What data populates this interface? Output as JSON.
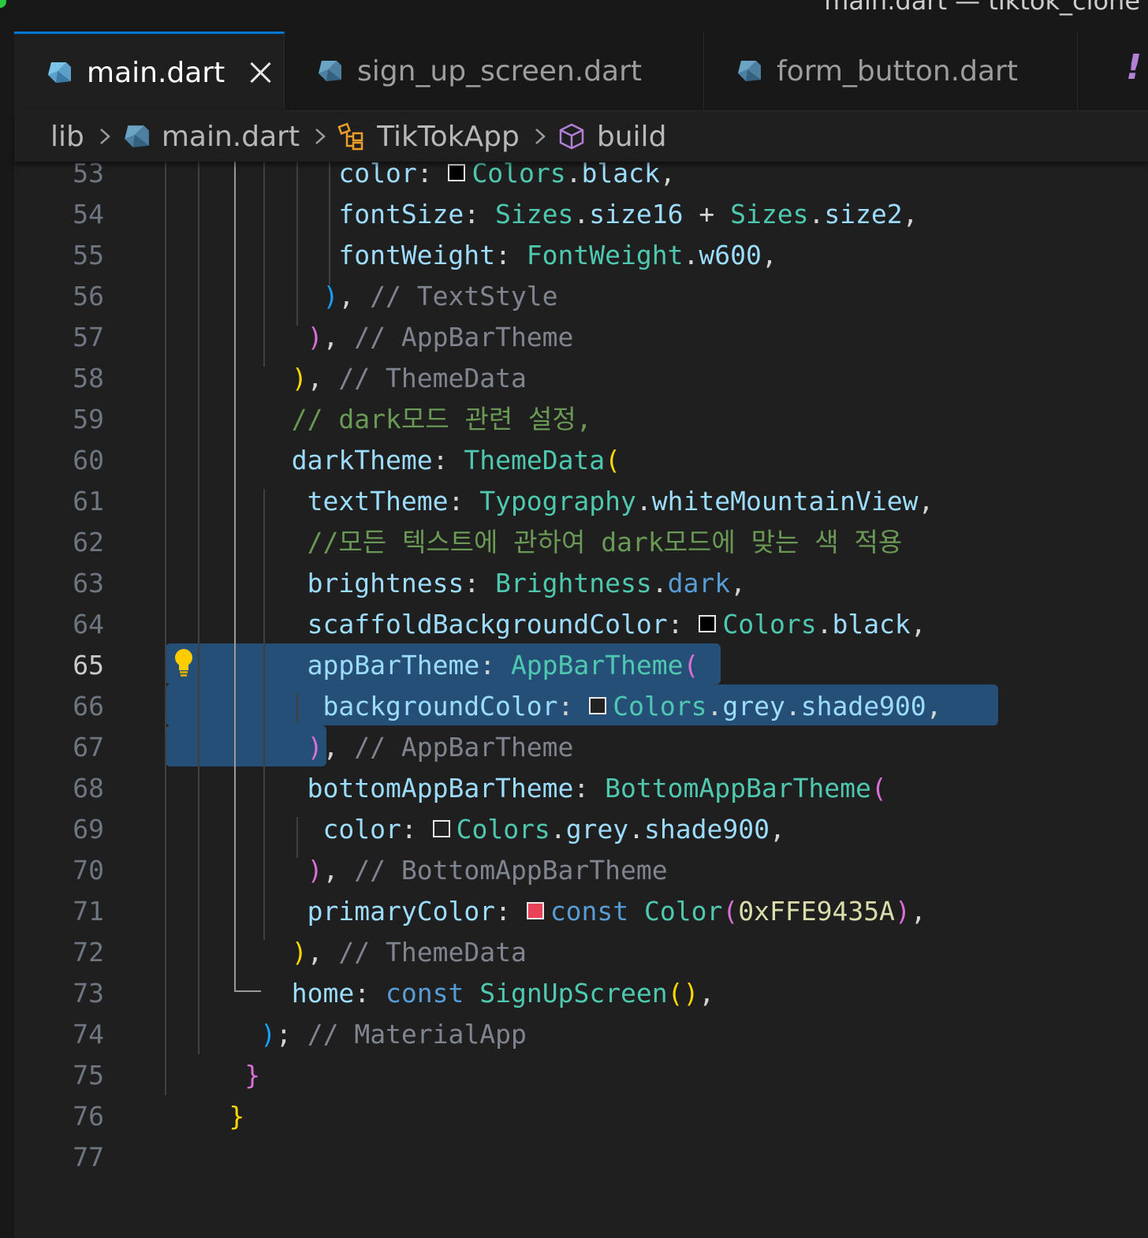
{
  "window": {
    "title": "main.dart — tiktok_clone"
  },
  "tabs": [
    {
      "label": "main.dart",
      "icon": "dart-icon",
      "active": true,
      "closable": true
    },
    {
      "label": "sign_up_screen.dart",
      "icon": "dart-icon",
      "active": false
    },
    {
      "label": "form_button.dart",
      "icon": "dart-icon",
      "active": false
    }
  ],
  "tab_overflow_indicator": "!",
  "breadcrumb": {
    "items": [
      {
        "label": "lib",
        "icon": null
      },
      {
        "label": "main.dart",
        "icon": "dart-icon"
      },
      {
        "label": "TikTokApp",
        "icon": "class-icon"
      },
      {
        "label": "build",
        "icon": "method-cube-icon"
      }
    ]
  },
  "editor": {
    "current_line": 65,
    "colors": {
      "keyword": "#569cd6",
      "property": "#9cdcfe",
      "type": "#4ec9b0",
      "method": "#dcdcaa",
      "comment": "#6a9955",
      "comment_gray": "#7f848e",
      "bracket_yellow": "#ffd700",
      "bracket_pink": "#da70d6",
      "bracket_blue": "#179fff",
      "selection": "#264f78"
    },
    "lines": [
      {
        "n": "53",
        "tokens": [
          [
            "prop",
            "color"
          ],
          [
            "plain",
            ": "
          ],
          [
            "swatch",
            "#000000"
          ],
          [
            "type",
            "Colors"
          ],
          [
            "plain",
            "."
          ],
          [
            "prop",
            "black"
          ],
          [
            "plain",
            ","
          ]
        ]
      },
      {
        "n": "54",
        "tokens": [
          [
            "prop",
            "fontSize"
          ],
          [
            "plain",
            ": "
          ],
          [
            "type",
            "Sizes"
          ],
          [
            "plain",
            "."
          ],
          [
            "prop",
            "size16"
          ],
          [
            "plain",
            " + "
          ],
          [
            "type",
            "Sizes"
          ],
          [
            "plain",
            "."
          ],
          [
            "prop",
            "size2"
          ],
          [
            "plain",
            ","
          ]
        ]
      },
      {
        "n": "55",
        "tokens": [
          [
            "prop",
            "fontWeight"
          ],
          [
            "plain",
            ": "
          ],
          [
            "type",
            "FontWeight"
          ],
          [
            "plain",
            "."
          ],
          [
            "prop",
            "w600"
          ],
          [
            "plain",
            ","
          ]
        ]
      },
      {
        "n": "56",
        "tokens": [
          [
            "bblue",
            ")"
          ],
          [
            "plain",
            ", "
          ],
          [
            "gcomment",
            "// TextStyle"
          ]
        ]
      },
      {
        "n": "57",
        "tokens": [
          [
            "bpink",
            ")"
          ],
          [
            "plain",
            ", "
          ],
          [
            "gcomment",
            "// AppBarTheme"
          ]
        ]
      },
      {
        "n": "58",
        "tokens": [
          [
            "byellow",
            ")"
          ],
          [
            "plain",
            ", "
          ],
          [
            "gcomment",
            "// ThemeData"
          ]
        ]
      },
      {
        "n": "59",
        "tokens": [
          [
            "comment",
            "// dark모드 관련 설정,"
          ]
        ]
      },
      {
        "n": "60",
        "tokens": [
          [
            "prop",
            "darkTheme"
          ],
          [
            "plain",
            ": "
          ],
          [
            "type",
            "ThemeData"
          ],
          [
            "byellow",
            "("
          ]
        ]
      },
      {
        "n": "61",
        "tokens": [
          [
            "prop",
            "textTheme"
          ],
          [
            "plain",
            ": "
          ],
          [
            "type",
            "Typography"
          ],
          [
            "plain",
            "."
          ],
          [
            "prop",
            "whiteMountainView"
          ],
          [
            "plain",
            ","
          ]
        ]
      },
      {
        "n": "62",
        "tokens": [
          [
            "comment",
            "//모든 텍스트에 관하여 dark모드에 맞는 색 적용"
          ]
        ]
      },
      {
        "n": "63",
        "tokens": [
          [
            "prop",
            "brightness"
          ],
          [
            "plain",
            ": "
          ],
          [
            "type",
            "Brightness"
          ],
          [
            "plain",
            "."
          ],
          [
            "kw",
            "dark"
          ],
          [
            "plain",
            ","
          ]
        ]
      },
      {
        "n": "64",
        "tokens": [
          [
            "prop",
            "scaffoldBackgroundColor"
          ],
          [
            "plain",
            ": "
          ],
          [
            "swatch",
            "#000000"
          ],
          [
            "type",
            "Colors"
          ],
          [
            "plain",
            "."
          ],
          [
            "prop",
            "black"
          ],
          [
            "plain",
            ","
          ]
        ]
      },
      {
        "n": "65",
        "tokens": [
          [
            "prop",
            "appBarTheme"
          ],
          [
            "plain",
            ": "
          ],
          [
            "type",
            "AppBarTheme"
          ],
          [
            "bpink",
            "("
          ]
        ]
      },
      {
        "n": "66",
        "tokens": [
          [
            "prop",
            "backgroundColor"
          ],
          [
            "plain",
            ": "
          ],
          [
            "swatch",
            "#212121"
          ],
          [
            "type",
            "Colors"
          ],
          [
            "plain",
            "."
          ],
          [
            "prop",
            "grey"
          ],
          [
            "plain",
            "."
          ],
          [
            "prop",
            "shade900"
          ],
          [
            "plain",
            ","
          ]
        ]
      },
      {
        "n": "67",
        "tokens": [
          [
            "bpink",
            ")"
          ],
          [
            "plain",
            ", "
          ],
          [
            "gcomment",
            "// AppBarTheme"
          ]
        ]
      },
      {
        "n": "68",
        "tokens": [
          [
            "prop",
            "bottomAppBarTheme"
          ],
          [
            "plain",
            ": "
          ],
          [
            "type",
            "BottomAppBarTheme"
          ],
          [
            "bpink",
            "("
          ]
        ]
      },
      {
        "n": "69",
        "tokens": [
          [
            "prop",
            "color"
          ],
          [
            "plain",
            ": "
          ],
          [
            "swatch",
            "#212121"
          ],
          [
            "type",
            "Colors"
          ],
          [
            "plain",
            "."
          ],
          [
            "prop",
            "grey"
          ],
          [
            "plain",
            "."
          ],
          [
            "prop",
            "shade900"
          ],
          [
            "plain",
            ","
          ]
        ]
      },
      {
        "n": "70",
        "tokens": [
          [
            "bpink",
            ")"
          ],
          [
            "plain",
            ", "
          ],
          [
            "gcomment",
            "// BottomAppBarTheme"
          ]
        ]
      },
      {
        "n": "71",
        "tokens": [
          [
            "prop",
            "primaryColor"
          ],
          [
            "plain",
            ": "
          ],
          [
            "swatch",
            "#E9435A"
          ],
          [
            "kw",
            "const"
          ],
          [
            "plain",
            " "
          ],
          [
            "type",
            "Color"
          ],
          [
            "bpink",
            "("
          ],
          [
            "num",
            "0xFFE9435A"
          ],
          [
            "bpink",
            ")"
          ],
          [
            "plain",
            ","
          ]
        ]
      },
      {
        "n": "72",
        "tokens": [
          [
            "byellow",
            ")"
          ],
          [
            "plain",
            ", "
          ],
          [
            "gcomment",
            "// ThemeData"
          ]
        ]
      },
      {
        "n": "73",
        "tokens": [
          [
            "prop",
            "home"
          ],
          [
            "plain",
            ": "
          ],
          [
            "kw",
            "const"
          ],
          [
            "plain",
            " "
          ],
          [
            "type",
            "SignUpScreen"
          ],
          [
            "byellow",
            "()"
          ],
          [
            "plain",
            ","
          ]
        ]
      },
      {
        "n": "74",
        "tokens": [
          [
            "bblue",
            ")"
          ],
          [
            "plain",
            "; "
          ],
          [
            "gcomment",
            "// MaterialApp"
          ]
        ]
      },
      {
        "n": "75",
        "tokens": [
          [
            "bpink",
            "}"
          ]
        ]
      },
      {
        "n": "76",
        "tokens": [
          [
            "byellow",
            "}"
          ]
        ]
      },
      {
        "n": "77",
        "tokens": []
      }
    ]
  }
}
